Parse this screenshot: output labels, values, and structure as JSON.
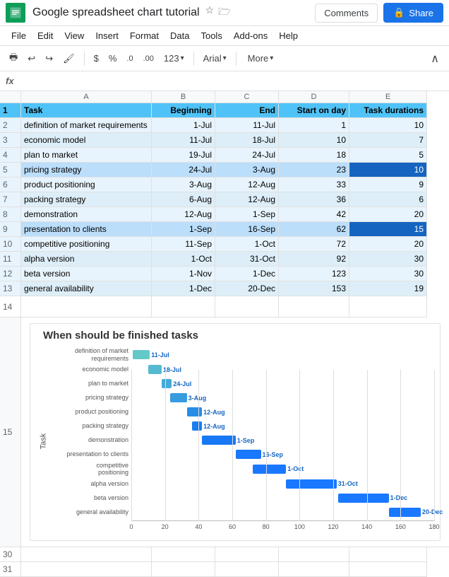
{
  "app": {
    "icon_alt": "Google Sheets",
    "title": "Google spreadsheet chart tutorial",
    "star_label": "★",
    "folder_label": "🗁"
  },
  "menu": {
    "file": "File",
    "edit": "Edit",
    "view": "View",
    "insert": "Insert",
    "format": "Format",
    "data": "Data",
    "tools": "Tools",
    "addons": "Add-ons",
    "help": "Help"
  },
  "toolbar": {
    "print": "🖶",
    "undo": "↩",
    "redo": "↪",
    "paint": "🖌",
    "currency": "$",
    "percent": "%",
    "decimal_dec": ".0",
    "decimal_inc": ".00",
    "number_format": "123",
    "font": "Arial",
    "more": "More",
    "collapse": "∧"
  },
  "formula_bar": {
    "fx": "fx"
  },
  "columns": {
    "row_num": "",
    "a_header": "A",
    "b_header": "B",
    "c_header": "C",
    "d_header": "D",
    "e_header": "E"
  },
  "header_row": {
    "num": "1",
    "task": "Task",
    "beginning": "Beginning",
    "end": "End",
    "start_on_day": "Start on day",
    "task_durations": "Task durations"
  },
  "rows": [
    {
      "num": "2",
      "task": "definition of market requirements",
      "beginning": "1-Jul",
      "end": "11-Jul",
      "start": 1,
      "duration": 10
    },
    {
      "num": "3",
      "task": "economic model",
      "beginning": "11-Jul",
      "end": "18-Jul",
      "start": 10,
      "duration": 7
    },
    {
      "num": "4",
      "task": "plan to market",
      "beginning": "19-Jul",
      "end": "24-Jul",
      "start": 18,
      "duration": 5
    },
    {
      "num": "5",
      "task": "pricing strategy",
      "beginning": "24-Jul",
      "end": "3-Aug",
      "start": 23,
      "duration": 10,
      "highlight": true
    },
    {
      "num": "6",
      "task": "product positioning",
      "beginning": "3-Aug",
      "end": "12-Aug",
      "start": 33,
      "duration": 9
    },
    {
      "num": "7",
      "task": "packing strategy",
      "beginning": "6-Aug",
      "end": "12-Aug",
      "start": 36,
      "duration": 6
    },
    {
      "num": "8",
      "task": "demonstration",
      "beginning": "12-Aug",
      "end": "1-Sep",
      "start": 42,
      "duration": 20
    },
    {
      "num": "9",
      "task": "presentation to clients",
      "beginning": "1-Sep",
      "end": "16-Sep",
      "start": 62,
      "duration": 15,
      "highlight": true
    },
    {
      "num": "10",
      "task": "competitive positioning",
      "beginning": "11-Sep",
      "end": "1-Oct",
      "start": 72,
      "duration": 20
    },
    {
      "num": "11",
      "task": "alpha version",
      "beginning": "1-Oct",
      "end": "31-Oct",
      "start": 92,
      "duration": 30
    },
    {
      "num": "12",
      "task": "beta version",
      "beginning": "1-Nov",
      "end": "1-Dec",
      "start": 123,
      "duration": 30
    },
    {
      "num": "13",
      "task": "general availability",
      "beginning": "1-Dec",
      "end": "20-Dec",
      "start": 153,
      "duration": 19
    }
  ],
  "chart": {
    "title": "When should be finished tasks",
    "y_axis_label": "Task",
    "x_ticks": [
      0,
      20,
      40,
      60,
      80,
      100,
      120,
      140,
      160,
      180
    ],
    "tasks": [
      {
        "label": "definition of market\nrequirements",
        "start": 1,
        "end": 11,
        "end_label": "11-Jul"
      },
      {
        "label": "economic model",
        "start": 10,
        "end": 18,
        "end_label": "18-Jul"
      },
      {
        "label": "plan to market",
        "start": 18,
        "end": 24,
        "end_label": "24-Jul"
      },
      {
        "label": "pricing strategy",
        "start": 23,
        "end": 33,
        "end_label": "3-Aug"
      },
      {
        "label": "product positioning",
        "start": 33,
        "end": 42,
        "end_label": "12-Aug"
      },
      {
        "label": "packing strategy",
        "start": 36,
        "end": 42,
        "end_label": "12-Aug"
      },
      {
        "label": "demonstration",
        "start": 42,
        "end": 62,
        "end_label": "1-Sep"
      },
      {
        "label": "presentation to clients",
        "start": 62,
        "end": 77,
        "end_label": "16-Sep"
      },
      {
        "label": "competitive\npositioning",
        "start": 72,
        "end": 92,
        "end_label": "1-Oct"
      },
      {
        "label": "alpha version",
        "start": 92,
        "end": 122,
        "end_label": "31-Oct"
      },
      {
        "label": "beta version",
        "start": 123,
        "end": 153,
        "end_label": "1-Dec"
      },
      {
        "label": "general availability",
        "start": 153,
        "end": 172,
        "end_label": "20-Dec"
      }
    ],
    "bar_color_light": "#90caf9",
    "bar_color_dark": "#1976d2",
    "max_value": 180
  },
  "empty_rows": [
    "14",
    "30",
    "31"
  ],
  "share_label": "Share",
  "comments_label": "Comments",
  "lock_icon": "🔒"
}
